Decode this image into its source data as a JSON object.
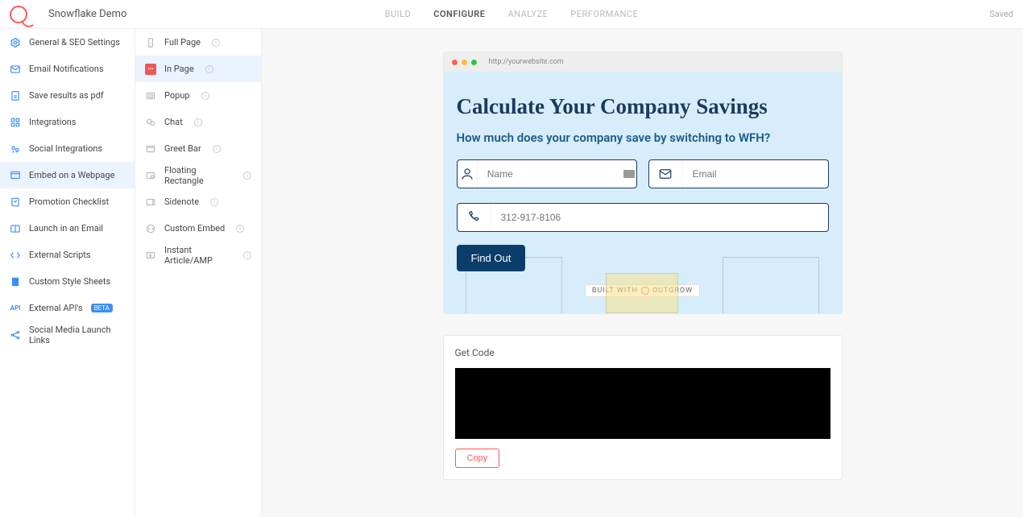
{
  "header": {
    "project_title": "Snowflake Demo",
    "tabs": [
      "BUILD",
      "CONFIGURE",
      "ANALYZE",
      "PERFORMANCE"
    ],
    "active_tab": "CONFIGURE",
    "saved_label": "Saved"
  },
  "sidebar1": {
    "items": [
      {
        "label": "General & SEO Settings",
        "icon": "settings-icon"
      },
      {
        "label": "Email Notifications",
        "icon": "mail-icon"
      },
      {
        "label": "Save results as pdf",
        "icon": "pdf-icon"
      },
      {
        "label": "Integrations",
        "icon": "integrations-icon"
      },
      {
        "label": "Social Integrations",
        "icon": "social-icon"
      },
      {
        "label": "Embed on a Webpage",
        "icon": "embed-icon",
        "active": true
      },
      {
        "label": "Promotion Checklist",
        "icon": "checklist-icon"
      },
      {
        "label": "Launch in an Email",
        "icon": "launch-email-icon"
      },
      {
        "label": "External Scripts",
        "icon": "code-icon"
      },
      {
        "label": "Custom Style Sheets",
        "icon": "stylesheet-icon"
      },
      {
        "label": "External API's",
        "icon": "api-icon",
        "badge": "BETA"
      },
      {
        "label": "Social Media Launch Links",
        "icon": "share-icon"
      }
    ]
  },
  "sidebar2": {
    "items": [
      {
        "label": "Full Page",
        "icon": "fullpage-icon"
      },
      {
        "label": "In Page",
        "icon": "inpage-icon",
        "active": true
      },
      {
        "label": "Popup",
        "icon": "popup-icon"
      },
      {
        "label": "Chat",
        "icon": "chat-icon"
      },
      {
        "label": "Greet Bar",
        "icon": "greetbar-icon"
      },
      {
        "label": "Floating Rectangle",
        "icon": "floatrect-icon"
      },
      {
        "label": "Sidenote",
        "icon": "sidenote-icon"
      },
      {
        "label": "Custom Embed",
        "icon": "customembed-icon"
      },
      {
        "label": "Instant Article/AMP",
        "icon": "amp-icon"
      }
    ]
  },
  "preview": {
    "browser_url": "http://yourwebsite.com",
    "title": "Calculate Your Company Savings",
    "subtitle": "How much does your company save by switching to WFH?",
    "name_placeholder": "Name",
    "email_placeholder": "Email",
    "phone_placeholder": "312-917-8106",
    "button_label": "Find Out",
    "built_with_prefix": "BUILT WITH",
    "built_with_brand": "OUTGROW"
  },
  "code_section": {
    "title": "Get Code",
    "copy_label": "Copy"
  }
}
